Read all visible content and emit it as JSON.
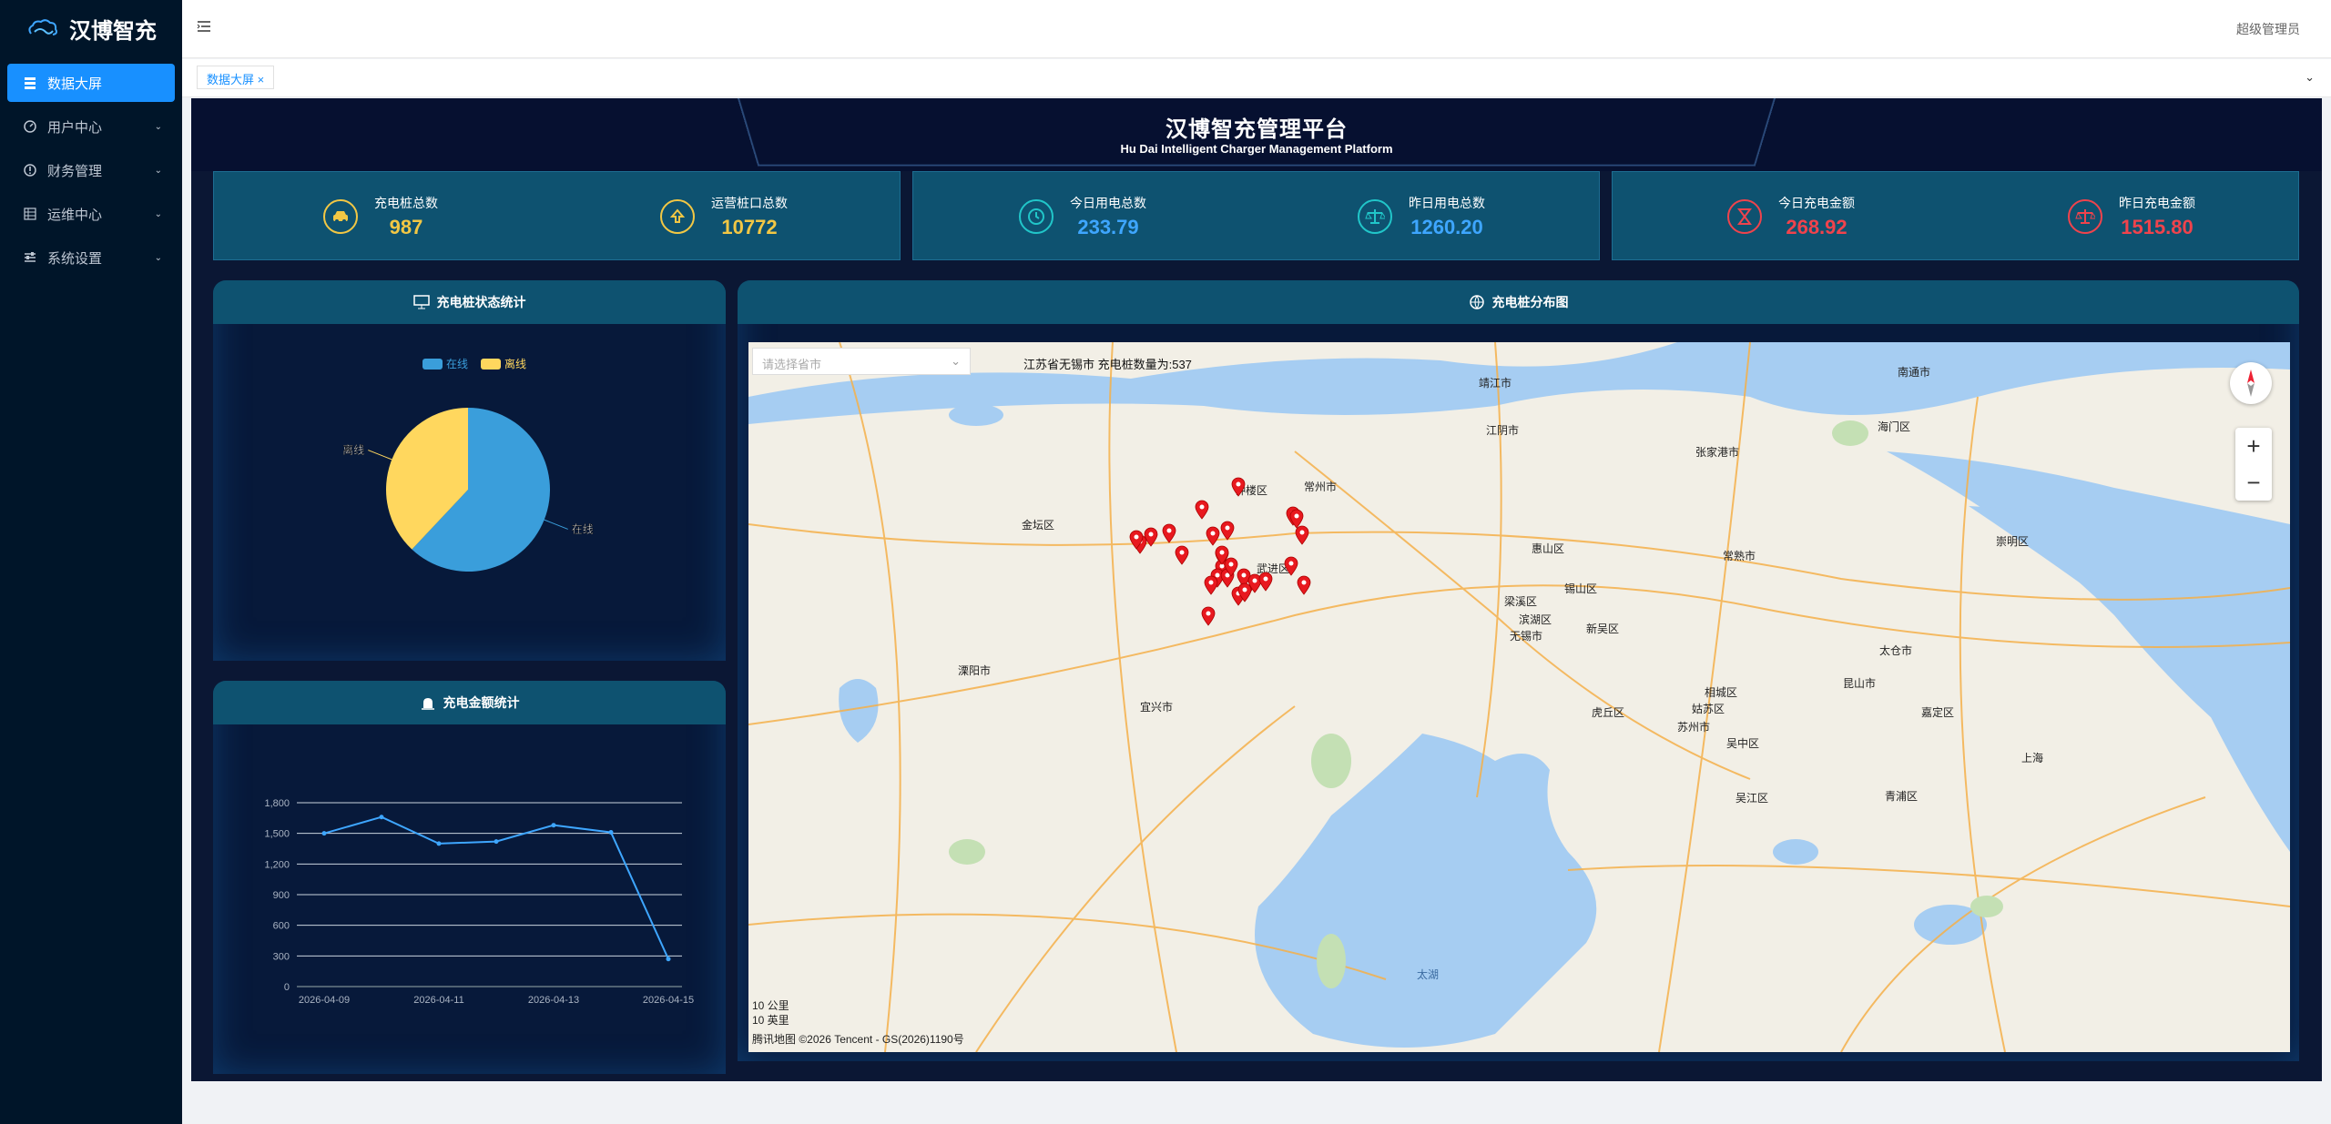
{
  "app": {
    "name": "汉博智充",
    "user": "超级管理员"
  },
  "sidebar": {
    "items": [
      {
        "label": "数据大屏",
        "icon": "dashboard-icon",
        "active": true
      },
      {
        "label": "用户中心",
        "icon": "user-center-icon"
      },
      {
        "label": "财务管理",
        "icon": "finance-icon"
      },
      {
        "label": "运维中心",
        "icon": "ops-icon"
      },
      {
        "label": "系统设置",
        "icon": "settings-icon"
      }
    ]
  },
  "tabs": [
    {
      "label": "数据大屏"
    }
  ],
  "screen": {
    "title": "汉博智充管理平台",
    "subtitle": "Hu Dai Intelligent Charger Management Platform"
  },
  "stats": [
    {
      "label": "充电桩总数",
      "value": "987",
      "color": "#f2c744",
      "icon": "car-icon"
    },
    {
      "label": "运营桩口总数",
      "value": "10772",
      "color": "#f2c744",
      "icon": "upload-icon"
    },
    {
      "label": "今日用电总数",
      "value": "233.79",
      "color": "#3ea6ff",
      "icon": "clock-icon"
    },
    {
      "label": "昨日用电总数",
      "value": "1260.20",
      "color": "#3ea6ff",
      "icon": "balance-icon"
    },
    {
      "label": "今日充电金额",
      "value": "268.92",
      "color": "#f0434c",
      "icon": "hourglass-icon"
    },
    {
      "label": "昨日充电金额",
      "value": "1515.80",
      "color": "#f0434c",
      "icon": "scale-icon"
    }
  ],
  "panels": {
    "status": "充电桩状态统计",
    "amount": "充电金额统计",
    "map": "充电桩分布图"
  },
  "chart_data": [
    {
      "type": "pie",
      "legend": [
        "在线",
        "离线"
      ],
      "values": [
        {
          "name": "在线",
          "value": 62,
          "color": "#3a9edb"
        },
        {
          "name": "离线",
          "value": 38,
          "color": "#ffd75e"
        }
      ]
    },
    {
      "type": "line",
      "x": [
        "2026-04-09",
        "2026-04-10",
        "2026-04-11",
        "2026-04-12",
        "2026-04-13",
        "2026-04-14",
        "2026-04-15"
      ],
      "values": [
        1500,
        1660,
        1400,
        1420,
        1580,
        1510,
        270
      ],
      "ylim": [
        0,
        1800
      ],
      "yticks": [
        0,
        300,
        600,
        900,
        1200,
        1500,
        1800
      ],
      "xticks": [
        "2026-04-09",
        "2026-04-11",
        "2026-04-13",
        "2026-04-15"
      ]
    }
  ],
  "map": {
    "select_placeholder": "请选择省市",
    "info": "江苏省无锡市 充电桩数量为:537",
    "scale1": "10 公里",
    "scale2": "10 英里",
    "copyright": "腾讯地图 ©2026 Tencent - GS(2026)1190号",
    "lake": "太湖",
    "labels": [
      [
        "靖江市",
        802,
        36
      ],
      [
        "江阴市",
        810,
        88
      ],
      [
        "张家港市",
        1040,
        112
      ],
      [
        "常州市",
        610,
        150
      ],
      [
        "钟楼区",
        534,
        154
      ],
      [
        "武进区",
        558,
        240
      ],
      [
        "惠山区",
        860,
        218
      ],
      [
        "锡山区",
        896,
        262
      ],
      [
        "滨湖区",
        846,
        296
      ],
      [
        "无锡市",
        836,
        314
      ],
      [
        "梁溪区",
        830,
        276
      ],
      [
        "新吴区",
        920,
        306
      ],
      [
        "常熟市",
        1070,
        226
      ],
      [
        "金坛区",
        300,
        192
      ],
      [
        "溧阳市",
        230,
        352
      ],
      [
        "宜兴市",
        430,
        392
      ],
      [
        "苏州市",
        1020,
        414
      ],
      [
        "虎丘区",
        926,
        398
      ],
      [
        "相城区",
        1050,
        376
      ],
      [
        "姑苏区",
        1036,
        394
      ],
      [
        "吴中区",
        1074,
        432
      ],
      [
        "吴江区",
        1084,
        492
      ],
      [
        "昆山市",
        1202,
        366
      ],
      [
        "太仓市",
        1242,
        330
      ],
      [
        "南通市",
        1262,
        24
      ],
      [
        "海门区",
        1240,
        84
      ],
      [
        "嘉定区",
        1288,
        398
      ],
      [
        "崇明区",
        1370,
        210
      ],
      [
        "青浦区",
        1248,
        490
      ],
      [
        "上海",
        1398,
        448
      ]
    ]
  },
  "markers": [
    [
      538,
      170
    ],
    [
      498,
      195
    ],
    [
      442,
      225
    ],
    [
      430,
      233
    ],
    [
      426,
      228
    ],
    [
      462,
      221
    ],
    [
      476,
      245
    ],
    [
      510,
      224
    ],
    [
      526,
      218
    ],
    [
      520,
      246
    ],
    [
      520,
      260
    ],
    [
      515,
      270
    ],
    [
      508,
      278
    ],
    [
      526,
      270
    ],
    [
      530,
      258
    ],
    [
      548,
      280
    ],
    [
      544,
      270
    ],
    [
      556,
      276
    ],
    [
      538,
      290
    ],
    [
      545,
      286
    ],
    [
      505,
      312
    ],
    [
      596,
      257
    ],
    [
      610,
      278
    ],
    [
      608,
      223
    ],
    [
      598,
      202
    ],
    [
      602,
      205
    ],
    [
      568,
      274
    ],
    [
      520,
      245
    ]
  ]
}
